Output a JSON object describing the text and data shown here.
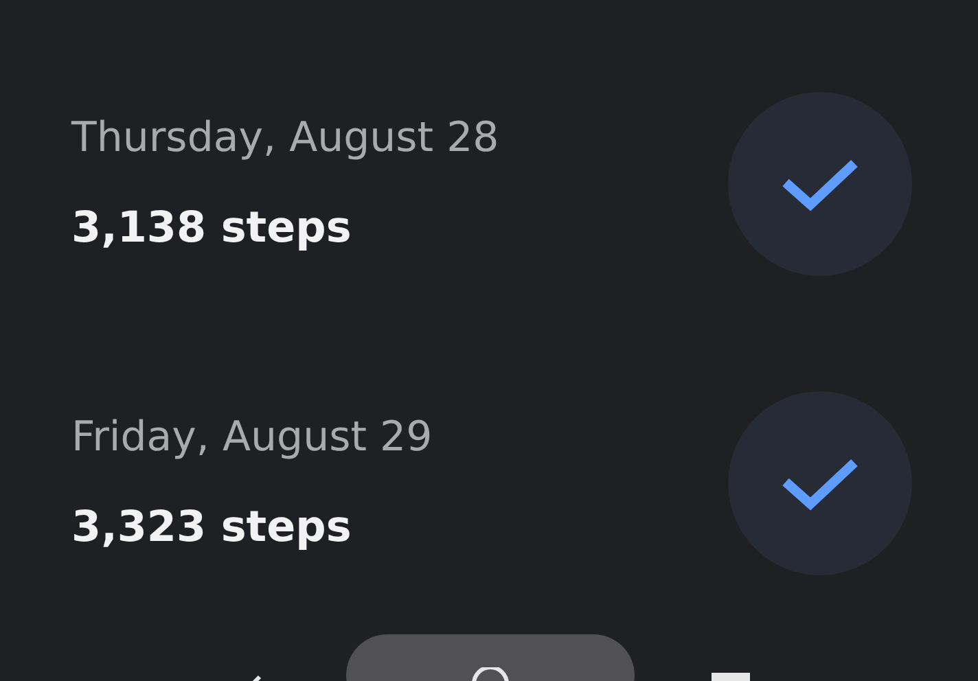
{
  "days": [
    {
      "date": "Thursday, August 28",
      "steps": "3,138 steps",
      "done": true
    },
    {
      "date": "Friday, August 29",
      "steps": "3,323 steps",
      "done": true
    }
  ]
}
